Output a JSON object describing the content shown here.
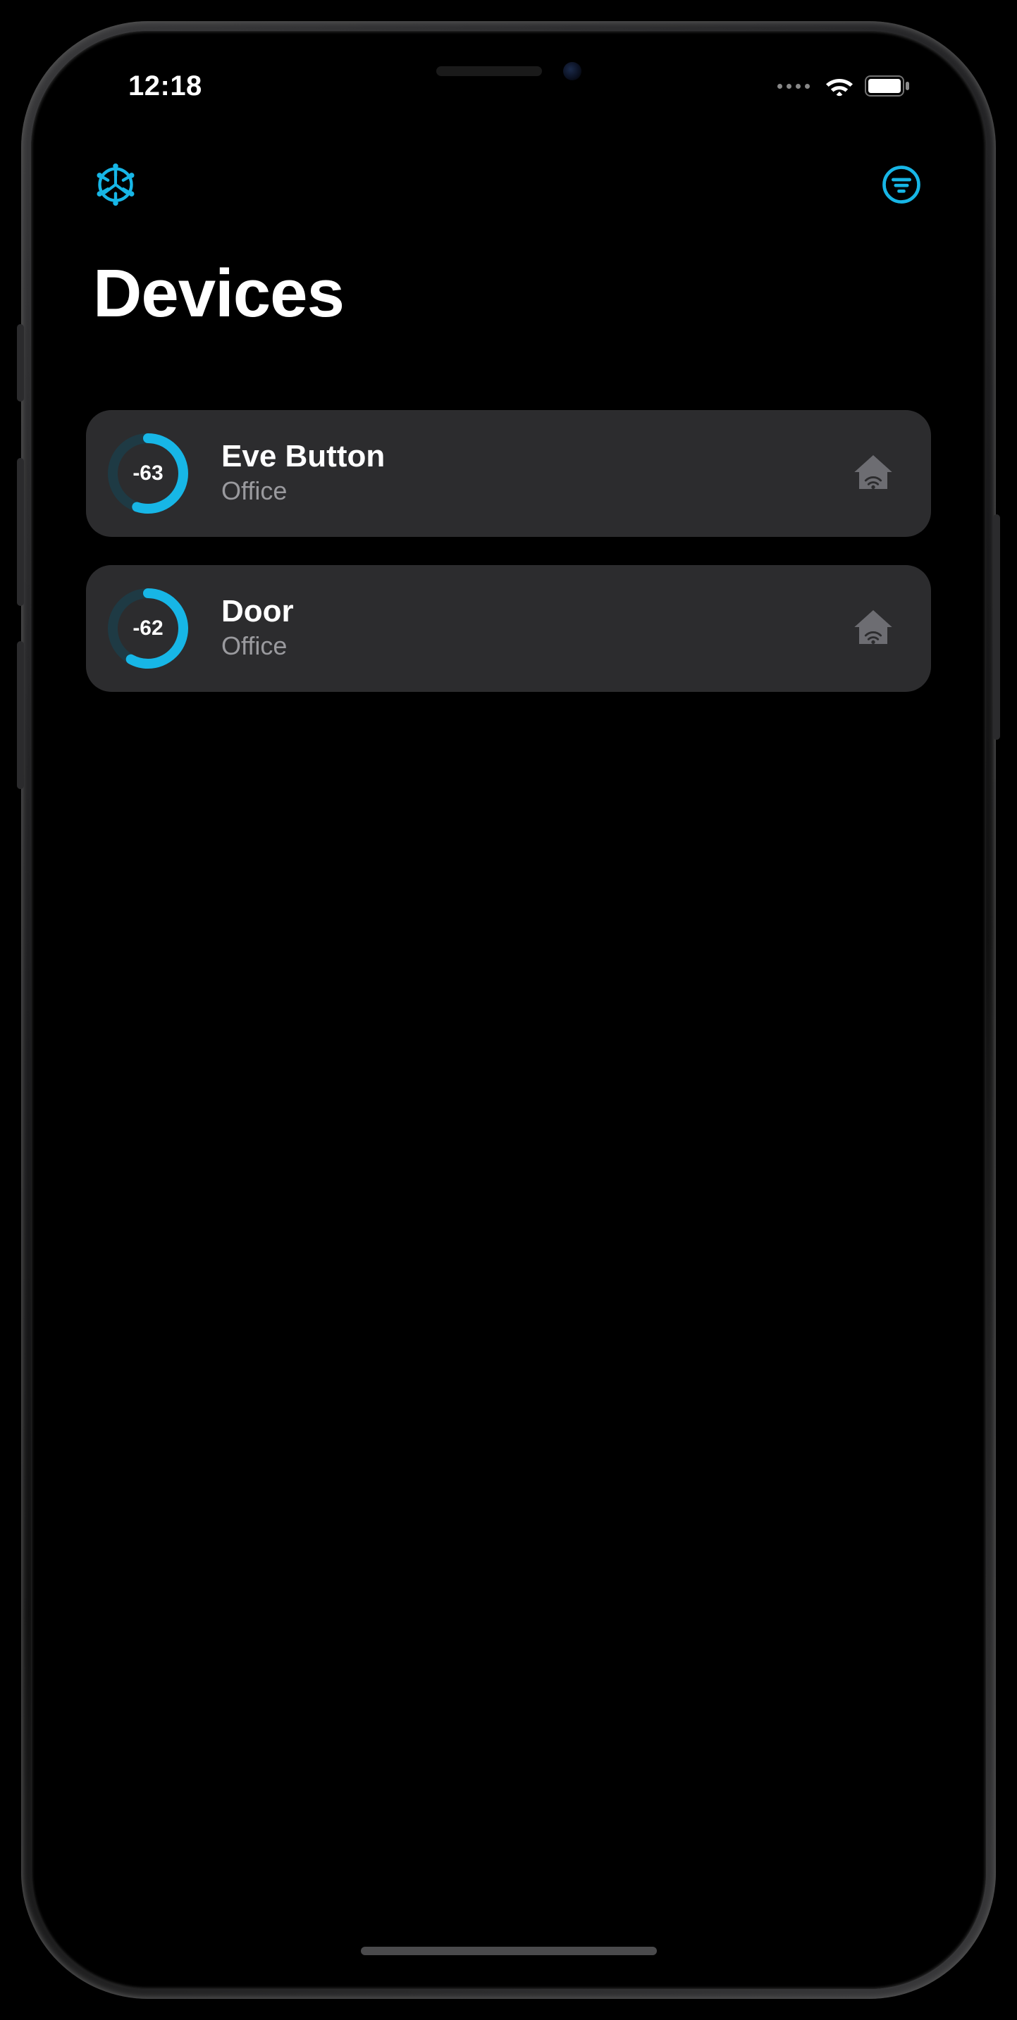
{
  "status": {
    "time": "12:18"
  },
  "page": {
    "title": "Devices"
  },
  "accent": "#17b6e6",
  "devices": [
    {
      "name": "Eve Button",
      "room": "Office",
      "signal": -63,
      "signal_pct": 0.55
    },
    {
      "name": "Door",
      "room": "Office",
      "signal": -62,
      "signal_pct": 0.58
    }
  ]
}
